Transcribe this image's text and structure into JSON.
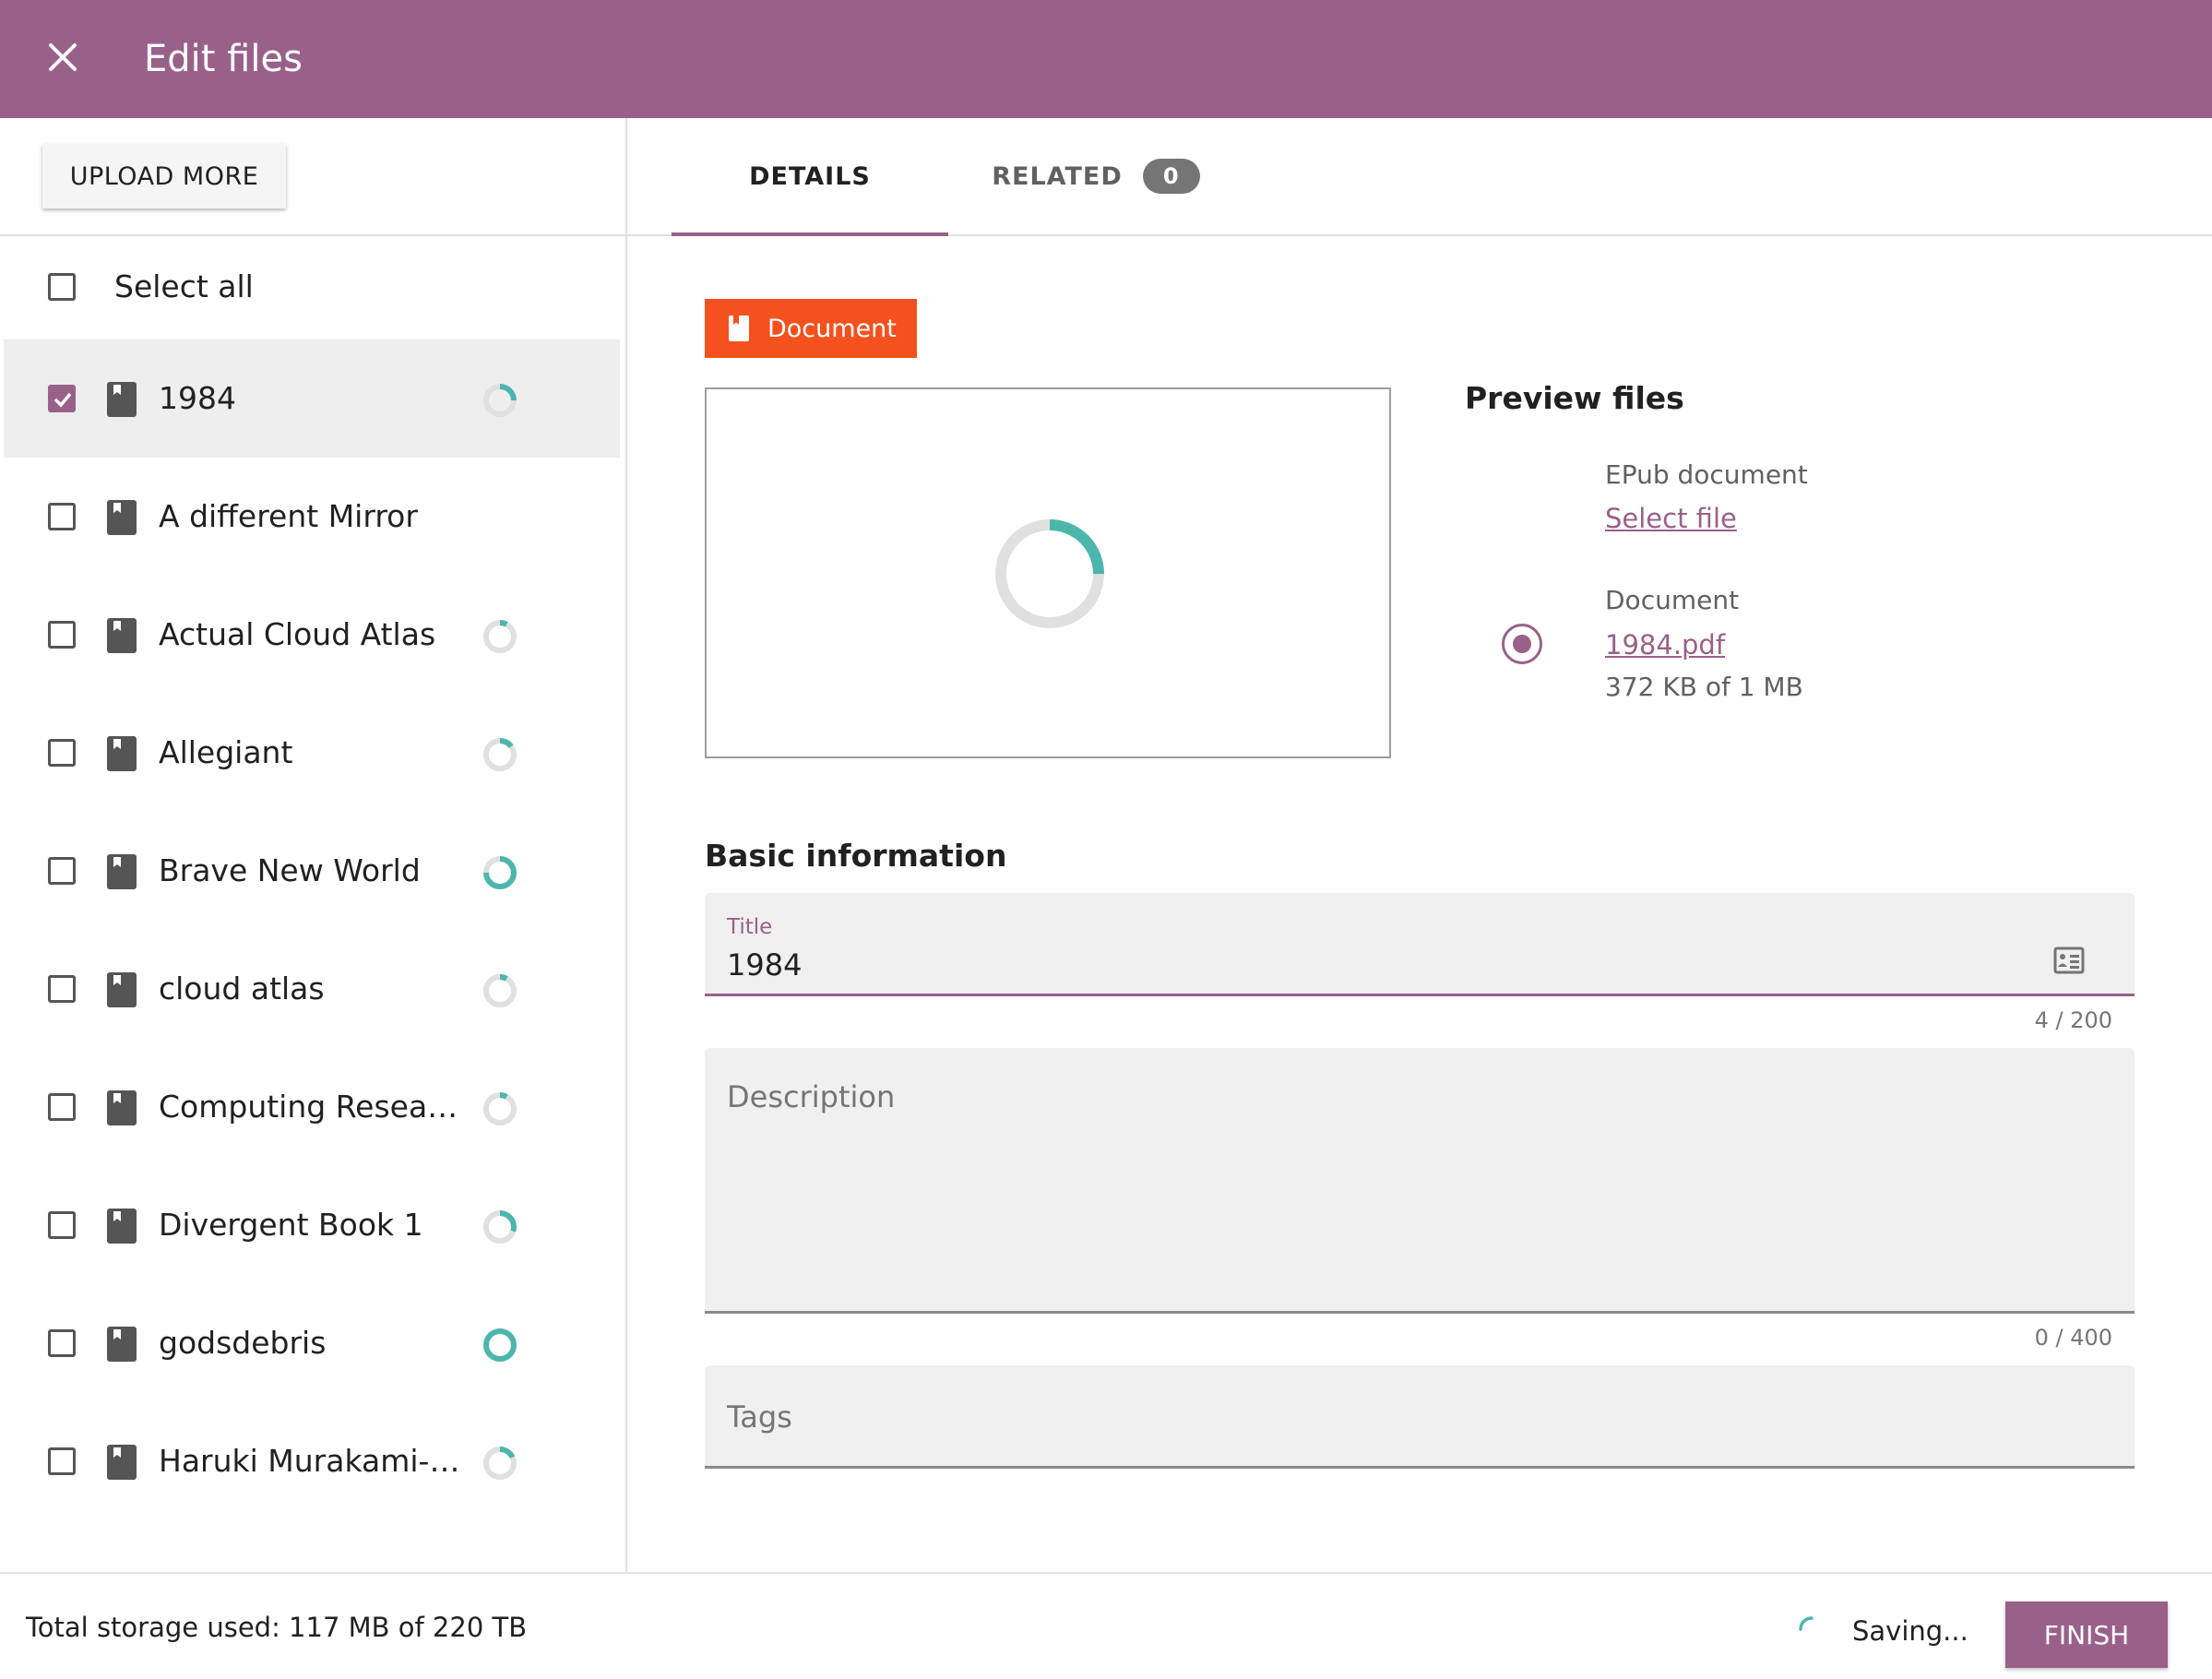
{
  "header": {
    "title": "Edit files"
  },
  "sidebar": {
    "upload_label": "UPLOAD MORE",
    "select_all_label": "Select all",
    "files": [
      {
        "name": "1984",
        "selected": true,
        "progress": 0.25
      },
      {
        "name": "A different Mirror",
        "selected": false,
        "progress": null
      },
      {
        "name": "Actual Cloud Atlas",
        "selected": false,
        "progress": 0.08
      },
      {
        "name": "Allegiant",
        "selected": false,
        "progress": 0.15
      },
      {
        "name": "Brave New World",
        "selected": false,
        "progress": 0.75
      },
      {
        "name": "cloud atlas",
        "selected": false,
        "progress": 0.08
      },
      {
        "name": "Computing Researc...",
        "selected": false,
        "progress": 0.08
      },
      {
        "name": "Divergent Book 1",
        "selected": false,
        "progress": 0.3
      },
      {
        "name": "godsdebris",
        "selected": false,
        "progress": 1.0
      },
      {
        "name": "Haruki Murakami-1...",
        "selected": false,
        "progress": 0.18
      }
    ]
  },
  "tabs": {
    "details_label": "DETAILS",
    "related_label": "RELATED",
    "related_count": "0"
  },
  "main": {
    "type_chip_label": "Document",
    "preview_progress": 0.25,
    "preview_files_title": "Preview files",
    "epub_label": "EPub document",
    "epub_link": "Select file",
    "document_label": "Document",
    "document_link": "1984.pdf",
    "document_size": "372 KB of 1 MB",
    "basic_info_title": "Basic information",
    "title_label": "Title",
    "title_value": "1984",
    "title_counter": "4 / 200",
    "description_placeholder": "Description",
    "description_counter": "0 / 400",
    "tags_placeholder": "Tags"
  },
  "footer": {
    "storage_text": "Total storage used: 117 MB of 220 TB",
    "saving_text": "Saving...",
    "finish_label": "FINISH"
  },
  "colors": {
    "brand": "#996189",
    "accent_progress": "#4db6ac",
    "chip": "#f4511e"
  }
}
